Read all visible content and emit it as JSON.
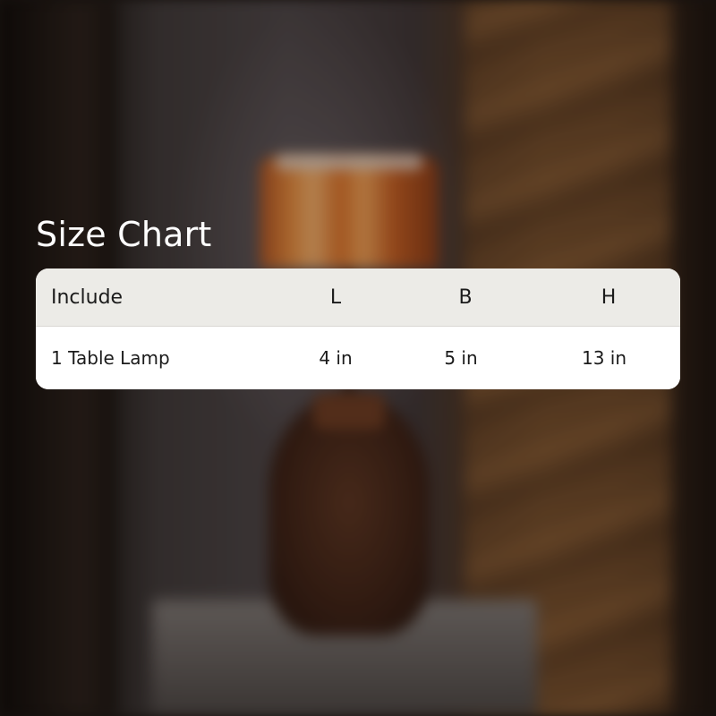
{
  "title": "Size Chart",
  "table": {
    "headers": [
      "Include",
      "L",
      "B",
      "H"
    ],
    "rows": [
      [
        "1 Table Lamp",
        "4 in",
        "5 in",
        "13 in"
      ]
    ]
  },
  "colors": {
    "heading_text": "#ffffff",
    "header_row_bg": "#ecebe7",
    "body_row_bg": "#ffffff",
    "cell_text": "#1b1b1b"
  }
}
